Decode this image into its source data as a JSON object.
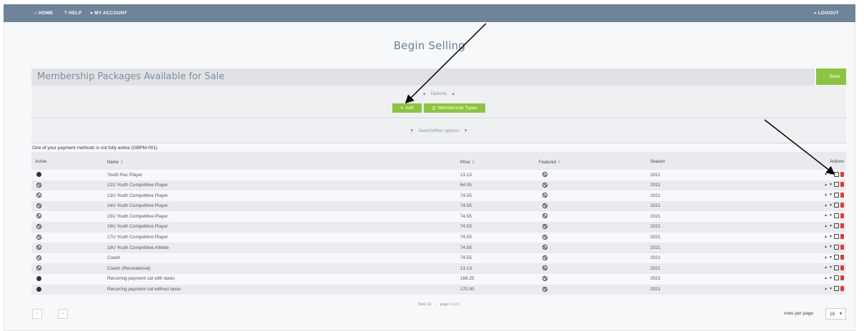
{
  "nav": {
    "home": "HOME",
    "help": "HELP",
    "account": "MY ACCOUNT",
    "logout": "LOGOUT"
  },
  "page_title": "Begin Selling",
  "panel": {
    "title": "Membership Packages Available for Sale",
    "back": "Back",
    "options": "Options",
    "add": "Add",
    "membership_types": "Membership Types",
    "search_filter": "Search/filter options"
  },
  "warning": "One of your payment methods is not fully active (GBPM-001)",
  "columns": {
    "active": "Active",
    "name": "Name",
    "price": "Price",
    "featured": "Featured",
    "season": "Season",
    "actions": "Actions"
  },
  "rows": [
    {
      "active": true,
      "name": "Youth Rec Player",
      "price": "13.13",
      "season": "2021"
    },
    {
      "active": false,
      "name": "12U Youth Competitive Player",
      "price": "64.05",
      "season": "2021"
    },
    {
      "active": false,
      "name": "13U Youth Competitive Player",
      "price": "74.55",
      "season": "2021"
    },
    {
      "active": false,
      "name": "14U Youth Competitive Player",
      "price": "74.55",
      "season": "2021"
    },
    {
      "active": false,
      "name": "15U Youth Competitive Player",
      "price": "74.55",
      "season": "2021"
    },
    {
      "active": false,
      "name": "16U Youth Competitive Player",
      "price": "74.55",
      "season": "2021"
    },
    {
      "active": false,
      "name": "17U Youth Competitive Player",
      "price": "74.55",
      "season": "2021"
    },
    {
      "active": false,
      "name": "18U Youth Competitive Athlete",
      "price": "74.55",
      "season": "2021"
    },
    {
      "active": false,
      "name": "Coach",
      "price": "74.55",
      "season": "2021"
    },
    {
      "active": false,
      "name": "Coach (Recreational)",
      "price": "13.13",
      "season": "2021"
    },
    {
      "active": true,
      "name": "Recurring payment cat with taxes",
      "price": "168.25",
      "season": "2021"
    },
    {
      "active": true,
      "name": "Recurring payment cat without taxes",
      "price": "170.00",
      "season": "2021"
    }
  ],
  "pagination": {
    "total": "Total 12",
    "page": "page 1 of 1",
    "prev": "‹",
    "next": "›",
    "rows_per_page_label": "rows per page",
    "rows_per_page_value": "15"
  },
  "colors": {
    "topbar": "#6f8399",
    "accent_green": "#8cc43f",
    "delete_red": "#e53935"
  },
  "icons": {
    "home": "home-icon",
    "help": "question-icon",
    "account": "user-icon",
    "logout": "logout-icon",
    "add": "plus-icon",
    "types": "list-icon",
    "back": "arrow-left-icon",
    "inactive": "ban-icon",
    "active": "check-circle-icon"
  }
}
